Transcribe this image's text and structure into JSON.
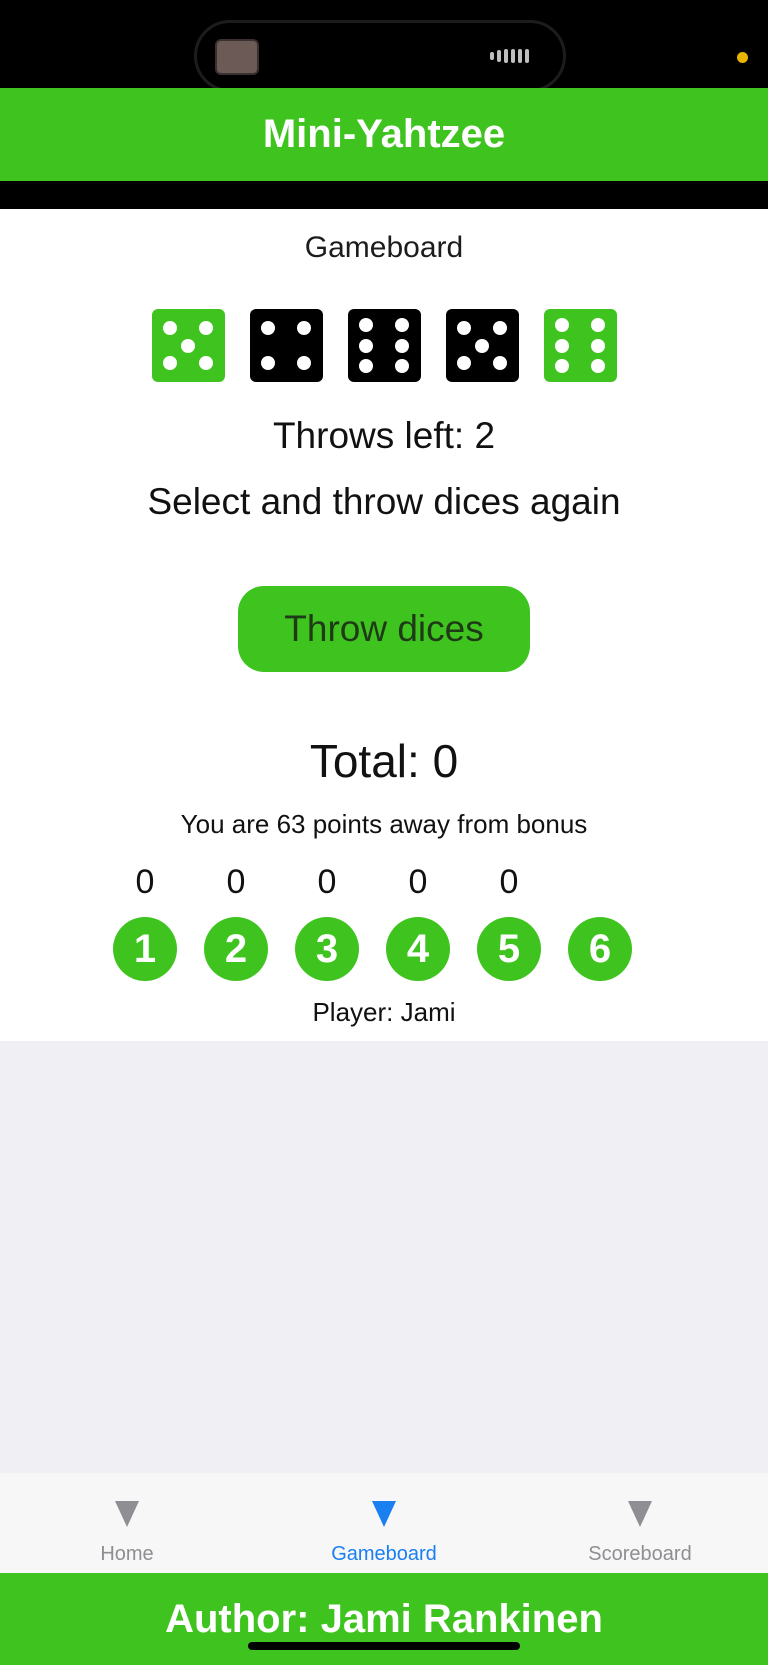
{
  "app": {
    "title": "Mini-Yahtzee"
  },
  "screen": {
    "subtitle": "Gameboard"
  },
  "dice": [
    {
      "value": 5,
      "selected": true
    },
    {
      "value": 4,
      "selected": false
    },
    {
      "value": 6,
      "selected": false
    },
    {
      "value": 5,
      "selected": false
    },
    {
      "value": 6,
      "selected": true
    }
  ],
  "game": {
    "throws_left": "Throws left: 2",
    "status": "Select and throw dices again",
    "throw_button": "Throw dices",
    "total": "Total: 0",
    "bonus": "You are 63 points away from bonus",
    "player": "Player: Jami"
  },
  "points": [
    "0",
    "0",
    "0",
    "0",
    "0"
  ],
  "numbers": [
    "1",
    "2",
    "3",
    "4",
    "5",
    "6"
  ],
  "tabs": [
    {
      "label": "Home",
      "active": false
    },
    {
      "label": "Gameboard",
      "active": true
    },
    {
      "label": "Scoreboard",
      "active": false
    }
  ],
  "footer": {
    "author": "Author: Jami Rankinen"
  },
  "colors": {
    "accent": "#3fc41f",
    "active_tab": "#1a7ff0",
    "inactive_tab": "#8e8e93"
  }
}
